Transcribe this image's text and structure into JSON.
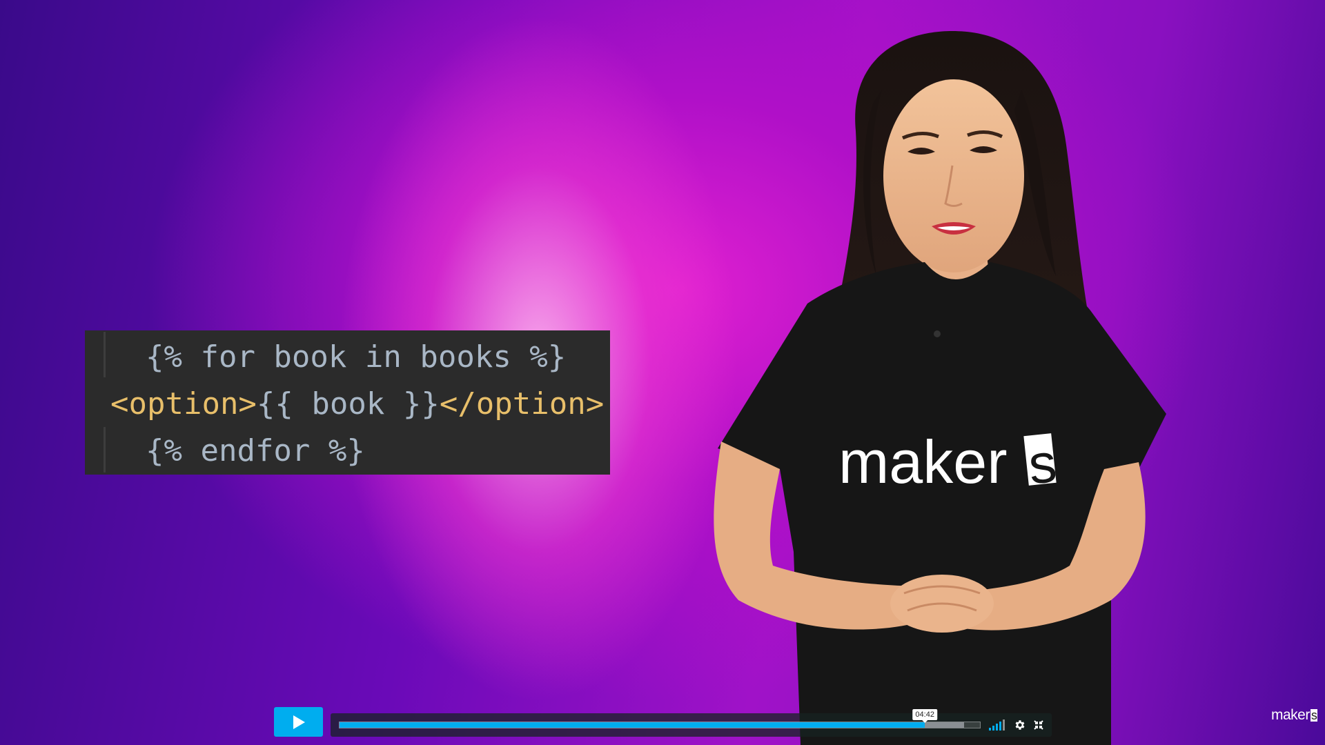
{
  "code": {
    "lines": [
      {
        "prefix": "  ",
        "text": "{% for book in books %}"
      },
      {
        "open_tag": "<option>",
        "body": "{{ book }}",
        "close_tag": "</option>"
      },
      {
        "prefix": "  ",
        "text": "{% endfor %}"
      }
    ]
  },
  "presenter": {
    "shirt_text": "maker",
    "shirt_text_end": "s"
  },
  "player": {
    "progress_fraction": 0.914,
    "buffered_fraction": 0.975,
    "hover_time": "04:42",
    "volume_level": 0.8,
    "icons": {
      "play": "play-icon",
      "volume": "volume-icon",
      "settings": "gear-icon",
      "fullscreen": "fullscreen-icon"
    },
    "accent_color": "#00adef"
  },
  "brand": {
    "logo_text": "maker",
    "logo_text_end": "s"
  }
}
